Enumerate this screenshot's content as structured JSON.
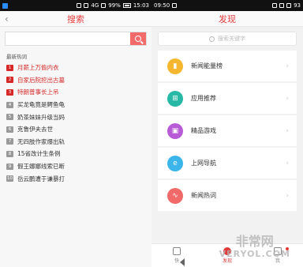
{
  "left_status": {
    "signal": "4G",
    "battery": "99%",
    "time": "15:03"
  },
  "right_status": {
    "time": "09:50",
    "battery": "93"
  },
  "search_page": {
    "title": "搜索",
    "back_icon": "back-arrow-icon",
    "input_placeholder": "",
    "section_title": "最新热词",
    "hot_words": [
      {
        "rank": "1",
        "text": "月薪上万偷内衣",
        "top": true
      },
      {
        "rank": "2",
        "text": "自家后院挖出古墓",
        "top": true
      },
      {
        "rank": "3",
        "text": "特朗普事长上吊",
        "top": true
      },
      {
        "rank": "4",
        "text": "买龙龟竟是鳄鱼龟",
        "top": false
      },
      {
        "rank": "5",
        "text": "奶茶妹妹升级当妈",
        "top": false
      },
      {
        "rank": "6",
        "text": "克鲁伊夫去世",
        "top": false
      },
      {
        "rank": "7",
        "text": "无四肢作家爆出轨",
        "top": false
      },
      {
        "rank": "8",
        "text": "15省改计生条例",
        "top": false
      },
      {
        "rank": "9",
        "text": "假王娜娜线索已断",
        "top": false
      },
      {
        "rank": "10",
        "text": "岳云鹏遭于谦暴打",
        "top": false
      }
    ]
  },
  "discover_page": {
    "title": "发现",
    "search_placeholder": "搜索关键字",
    "menu": [
      {
        "label": "新闻能量榜",
        "icon": "bar-chart-icon",
        "color": "#f5b731",
        "glyph": "▮"
      },
      {
        "label": "应用推荐",
        "icon": "apps-grid-icon",
        "color": "#28b8a6",
        "glyph": "⊞"
      },
      {
        "label": "精品游戏",
        "icon": "gamepad-icon",
        "color": "#b85bd6",
        "glyph": "▣"
      },
      {
        "label": "上网导航",
        "icon": "browser-e-icon",
        "color": "#3cb6ea",
        "glyph": "e"
      },
      {
        "label": "新闻热词",
        "icon": "trend-line-icon",
        "color": "#f06a6a",
        "glyph": "∿"
      }
    ],
    "tabs": [
      {
        "label": "快",
        "icon": "news-icon",
        "active": false,
        "dot": false
      },
      {
        "label": "发现",
        "icon": "discover-icon",
        "active": true,
        "dot": false
      },
      {
        "label": "我",
        "icon": "profile-icon",
        "active": false,
        "dot": true
      }
    ]
  },
  "watermark": {
    "line1": "非常网",
    "line2": "VERYOL.COM"
  },
  "colors": {
    "accent": "#e23b3b"
  }
}
